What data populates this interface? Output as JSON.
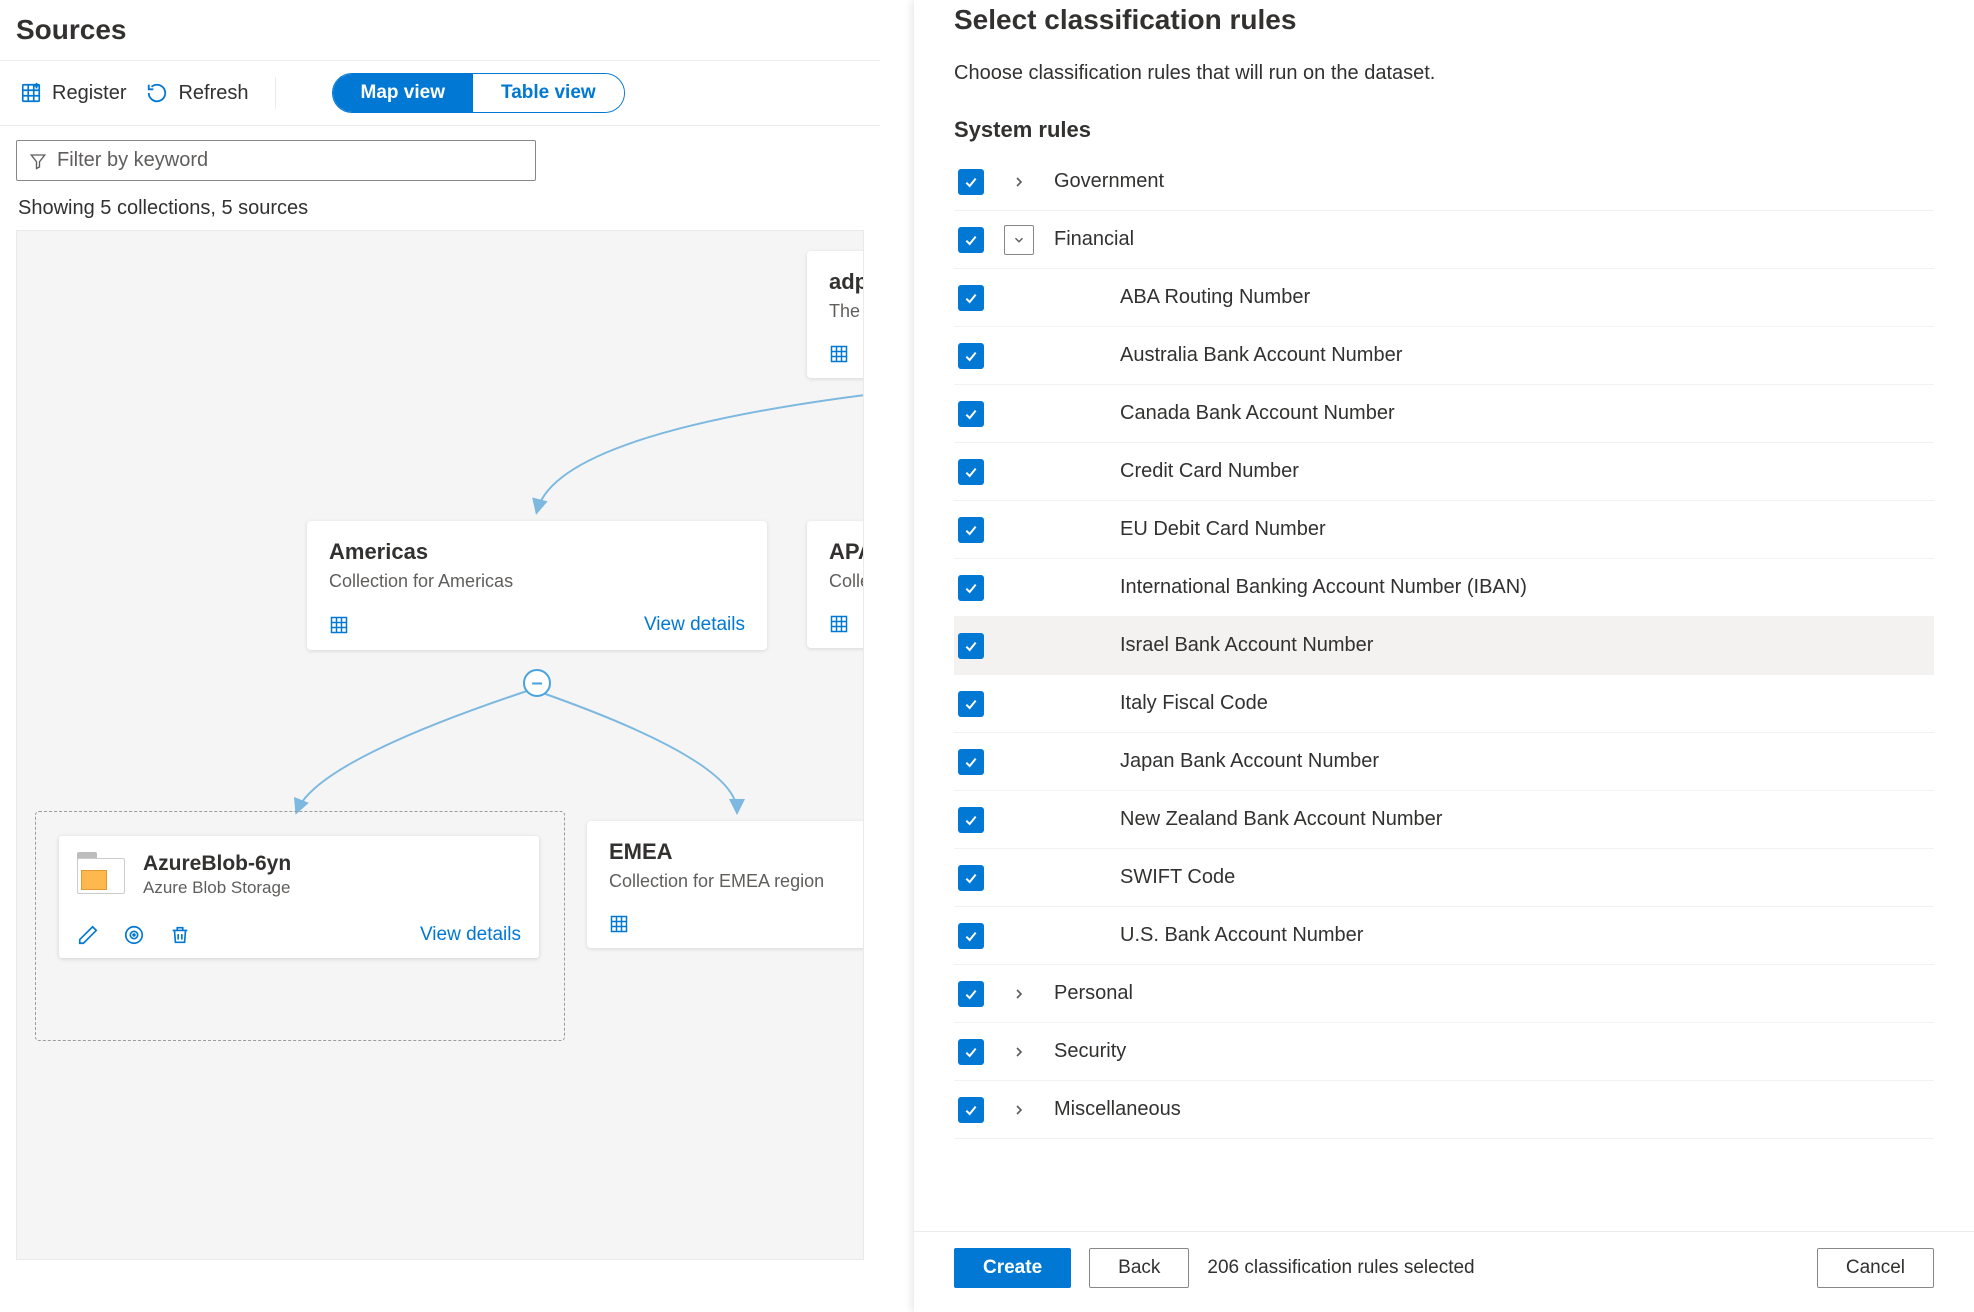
{
  "page": {
    "title": "Sources"
  },
  "toolbar": {
    "register": "Register",
    "refresh": "Refresh",
    "map_view": "Map view",
    "table_view": "Table view"
  },
  "filter": {
    "placeholder": "Filter by keyword"
  },
  "summary": "Showing 5 collections, 5 sources",
  "cards": {
    "root": {
      "title": "adpu",
      "sub": "The r"
    },
    "americas": {
      "title": "Americas",
      "sub": "Collection for Americas",
      "link": "View details"
    },
    "apac": {
      "title": "APA",
      "sub": "Colle"
    },
    "emea": {
      "title": "EMEA",
      "sub": "Collection for EMEA region"
    },
    "blob": {
      "title": "AzureBlob-6yn",
      "sub": "Azure Blob Storage",
      "link": "View details"
    }
  },
  "panel": {
    "title": "Select classification rules",
    "desc": "Choose classification rules that will run on the dataset.",
    "system_rules_heading": "System rules",
    "groups": [
      {
        "label": "Government",
        "expanded": false
      },
      {
        "label": "Financial",
        "expanded": true,
        "items": [
          "ABA Routing Number",
          "Australia Bank Account Number",
          "Canada Bank Account Number",
          "Credit Card Number",
          "EU Debit Card Number",
          "International Banking Account Number (IBAN)",
          "Israel Bank Account Number",
          "Italy Fiscal Code",
          "Japan Bank Account Number",
          "New Zealand Bank Account Number",
          "SWIFT Code",
          "U.S. Bank Account Number"
        ],
        "highlighted_index": 6
      },
      {
        "label": "Personal",
        "expanded": false
      },
      {
        "label": "Security",
        "expanded": false
      },
      {
        "label": "Miscellaneous",
        "expanded": false
      }
    ],
    "footer": {
      "create": "Create",
      "back": "Back",
      "status": "206 classification rules selected",
      "cancel": "Cancel"
    }
  }
}
